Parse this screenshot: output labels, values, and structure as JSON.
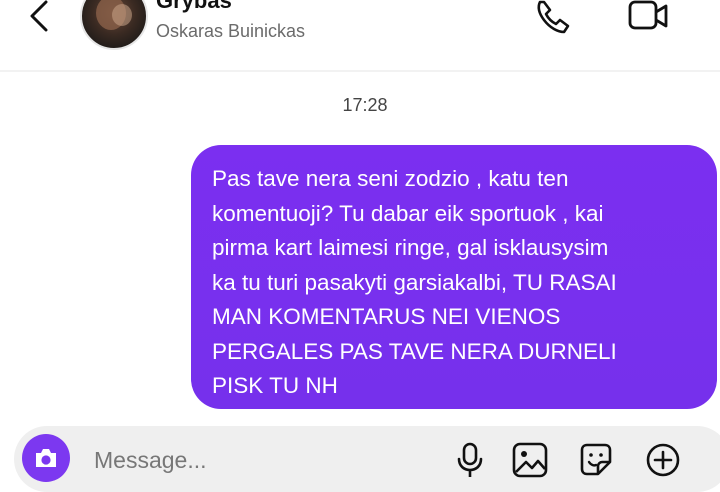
{
  "header": {
    "contact_name": "Grybas",
    "contact_username": "Oskaras Buinickas",
    "back_icon": "chevron-left-icon",
    "call_icon": "phone-icon",
    "video_icon": "video-camera-icon"
  },
  "conversation": {
    "timestamp": "17:28",
    "messages": [
      {
        "direction": "outgoing",
        "lines": [
          "Pas tave nera seni zodzio , katu ten",
          "komentuoji? Tu dabar eik sportuok , kai",
          "pirma kart laimesi ringe, gal isklausysim",
          "ka tu turi pasakyti garsiakalbi, TU RASAI",
          "MAN KOMENTARUS NEI VIENOS",
          "PERGALES PAS TAVE NERA DURNELI",
          "PISK TU NH"
        ]
      }
    ]
  },
  "composer": {
    "placeholder": "Message...",
    "camera_icon": "camera-icon",
    "mic_icon": "microphone-icon",
    "gallery_icon": "image-icon",
    "sticker_icon": "sticker-icon",
    "plus_icon": "plus-circle-icon"
  },
  "colors": {
    "bubble": "#7b2ff0",
    "camera_button": "#7c38f0",
    "composer_bg": "#efefef"
  }
}
